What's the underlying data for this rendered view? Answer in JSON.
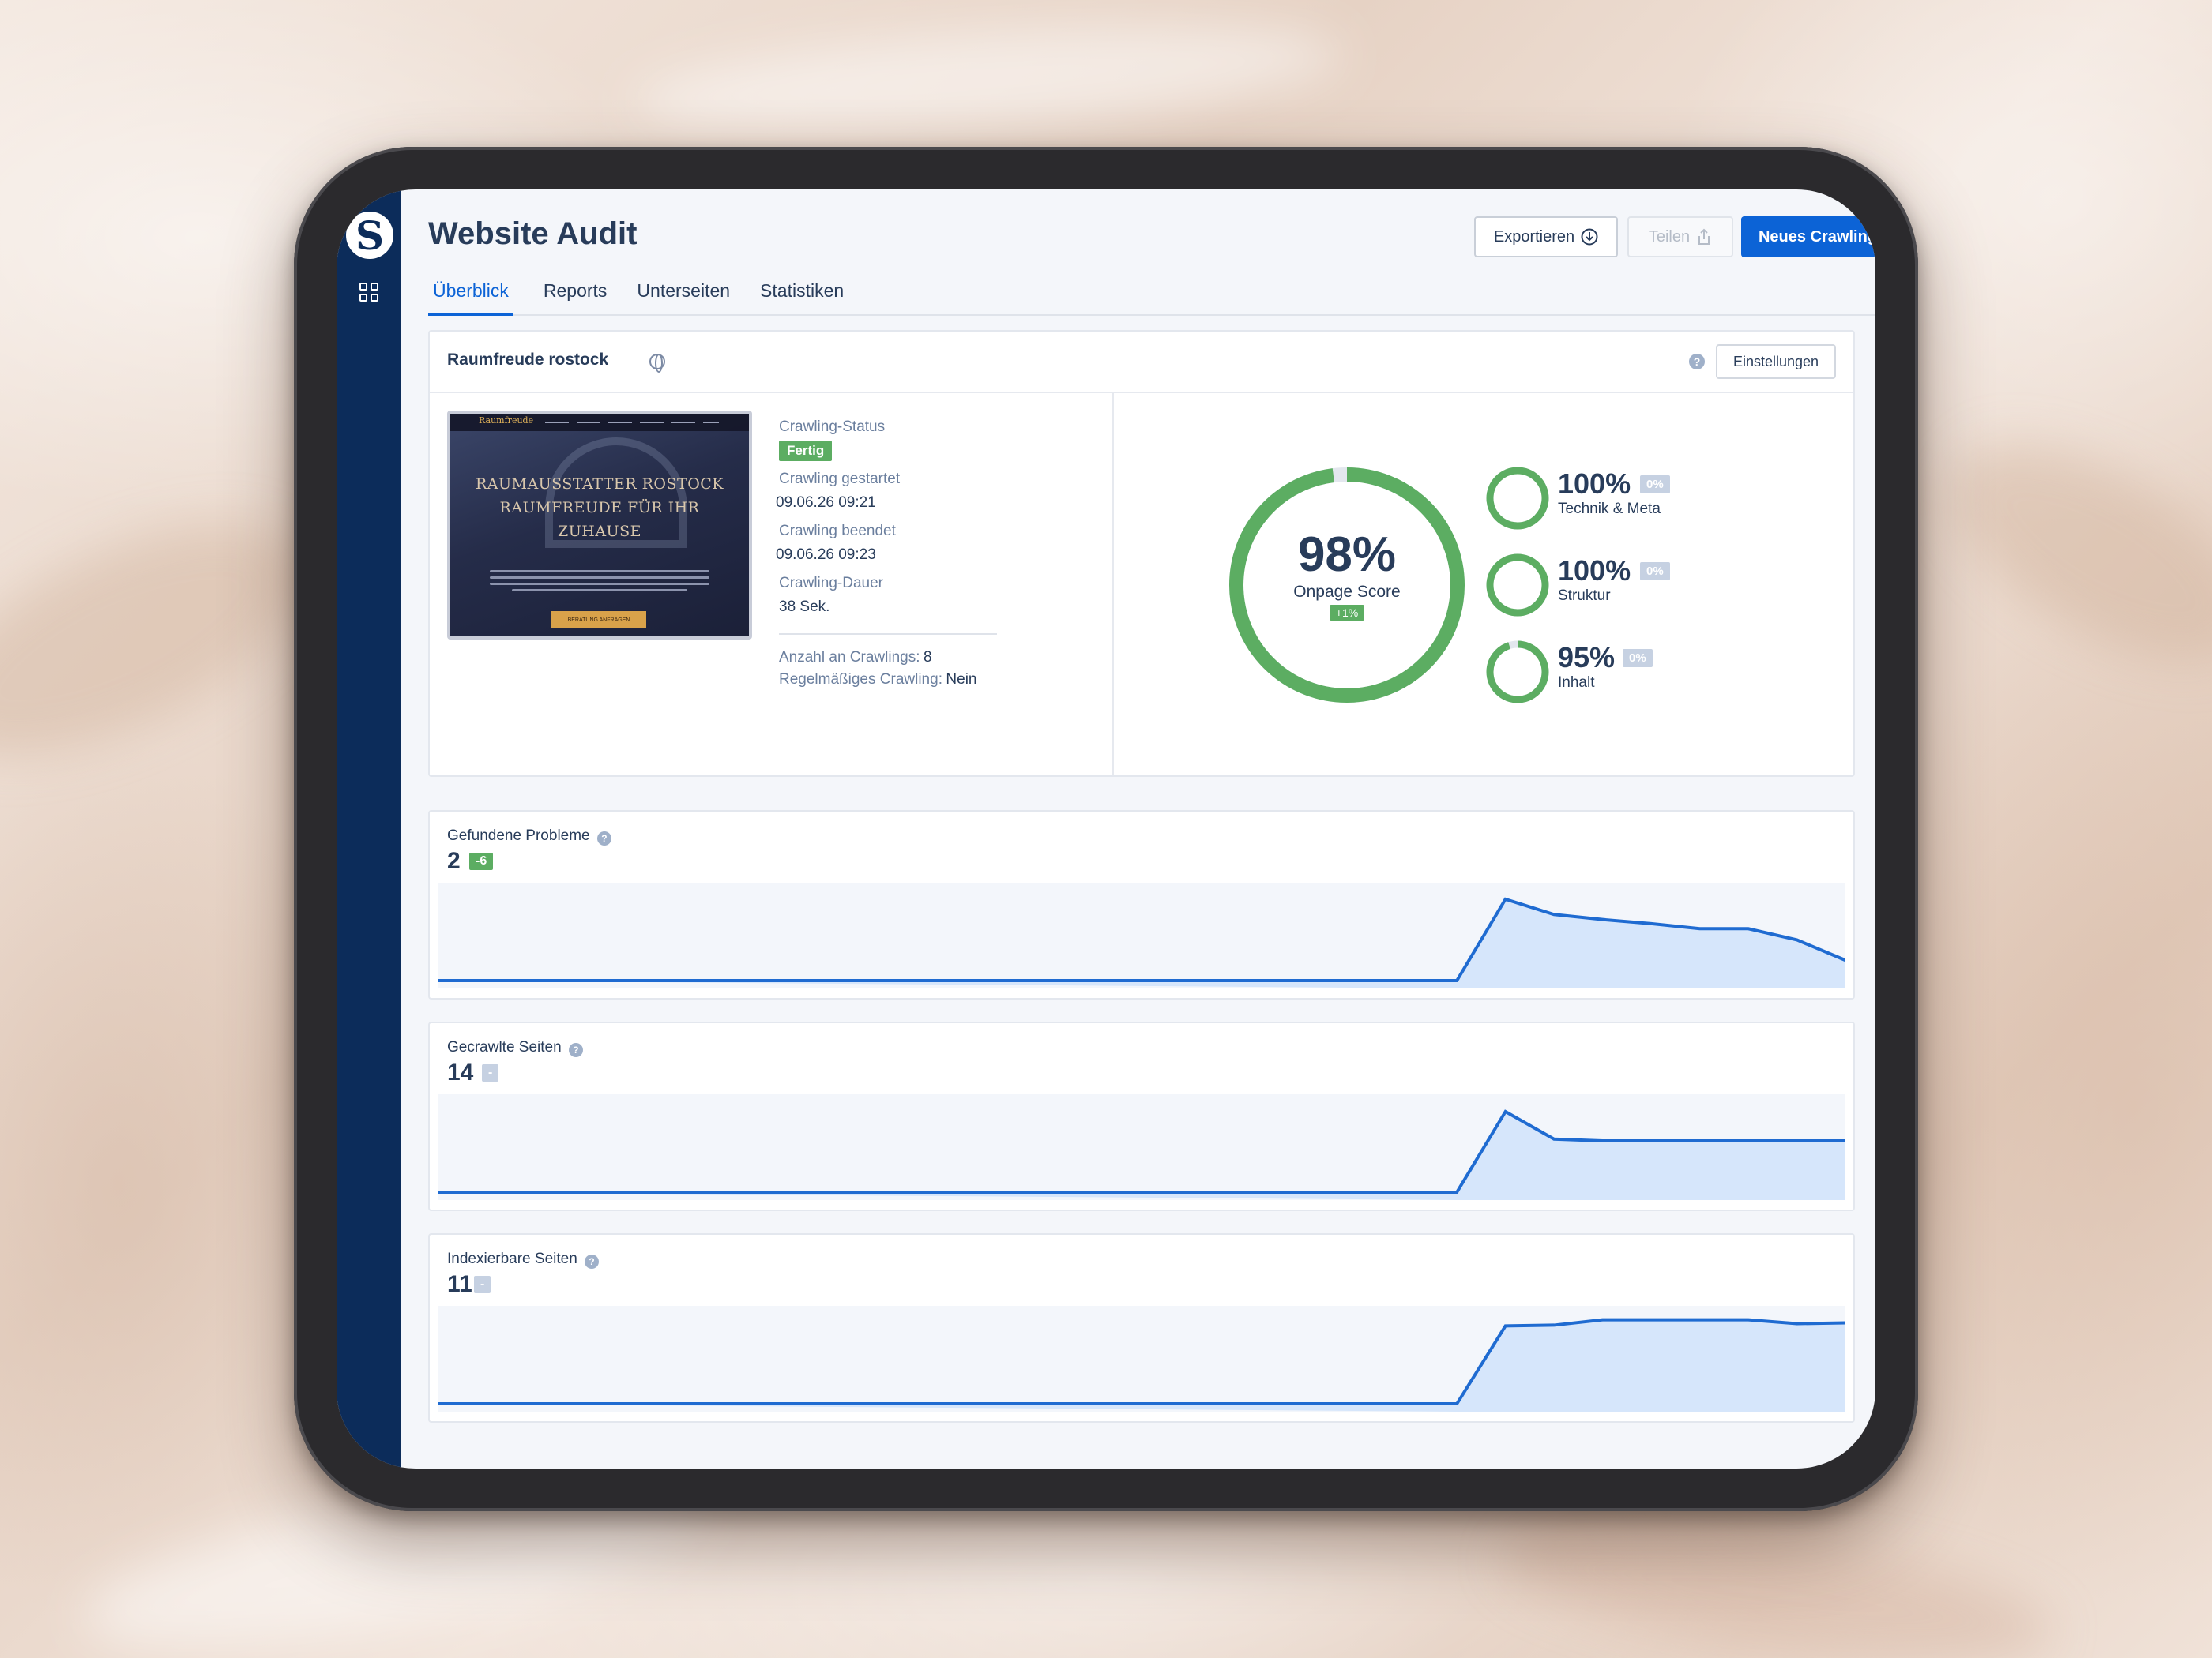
{
  "app": {
    "logo_letter": "S",
    "title": "Website Audit",
    "buttons": {
      "export": "Exportieren",
      "share": "Teilen",
      "new_crawl": "Neues Crawling"
    },
    "tabs": [
      "Überblick",
      "Reports",
      "Unterseiten",
      "Statistiken"
    ],
    "active_tab": "Überblick"
  },
  "project": {
    "name": "Raumfreude rostock",
    "settings_label": "Einstellungen",
    "thumbnail": {
      "brand": "Raumfreude",
      "hero_line1": "RAUMAUSSTATTER ROSTOCK",
      "hero_line2": "RAUMFREUDE FÜR IHR",
      "hero_line3": "ZUHAUSE",
      "cta": "BERATUNG ANFRAGEN"
    },
    "crawl": {
      "status_label": "Crawling-Status",
      "status_value": "Fertig",
      "started_label": "Crawling gestartet",
      "started_value": "09.06.26 09:21",
      "ended_label": "Crawling beendet",
      "ended_value": "09.06.26 09:23",
      "duration_label": "Crawling-Dauer",
      "duration_value": "38 Sek.",
      "count_label": "Anzahl an Crawlings:",
      "count_value": "8",
      "regular_label": "Regelmäßiges Crawling:",
      "regular_value": "Nein"
    }
  },
  "scores": {
    "onpage": {
      "value": "98%",
      "label": "Onpage Score",
      "delta": "+1%",
      "fraction": 0.98
    },
    "sub": [
      {
        "value": "100%",
        "label": "Technik & Meta",
        "delta": "0%",
        "fraction": 1.0
      },
      {
        "value": "100%",
        "label": "Struktur",
        "delta": "0%",
        "fraction": 1.0
      },
      {
        "value": "95%",
        "label": "Inhalt",
        "delta": "0%",
        "fraction": 0.95
      }
    ]
  },
  "colors": {
    "accent_blue": "#0c63d6",
    "sidebar": "#0c2c5a",
    "score_green": "#5cad62",
    "chart_line": "#1f6bd1",
    "chart_fill": "#d6e6fb"
  },
  "chart_data": [
    {
      "type": "area",
      "title": "Gefundene Probleme",
      "value": "2",
      "delta": "-6",
      "delta_color": "green",
      "x": [
        0,
        1,
        2,
        3,
        4,
        5,
        6,
        7,
        8,
        9
      ],
      "values": [
        0,
        0,
        8,
        6.5,
        6,
        5.6,
        5.1,
        5.1,
        4,
        2
      ],
      "ylim": [
        0,
        9
      ]
    },
    {
      "type": "area",
      "title": "Gecrawlte Seiten",
      "value": "14",
      "delta": "-",
      "delta_color": "gray",
      "x": [
        0,
        1,
        2,
        3,
        4,
        5,
        6,
        7,
        8,
        9
      ],
      "values": [
        0,
        0,
        22,
        14.5,
        14,
        14,
        14,
        14,
        14,
        14
      ],
      "ylim": [
        0,
        25
      ]
    },
    {
      "type": "area",
      "title": "Indexierbare Seiten",
      "value": "11",
      "delta": "-",
      "delta_color": "gray",
      "x": [
        0,
        1,
        2,
        3,
        4,
        5,
        6,
        7,
        8,
        9
      ],
      "values": [
        0,
        0,
        10.2,
        10.3,
        11,
        11,
        11,
        11,
        10.5,
        10.6
      ],
      "ylim": [
        0,
        12
      ]
    }
  ]
}
